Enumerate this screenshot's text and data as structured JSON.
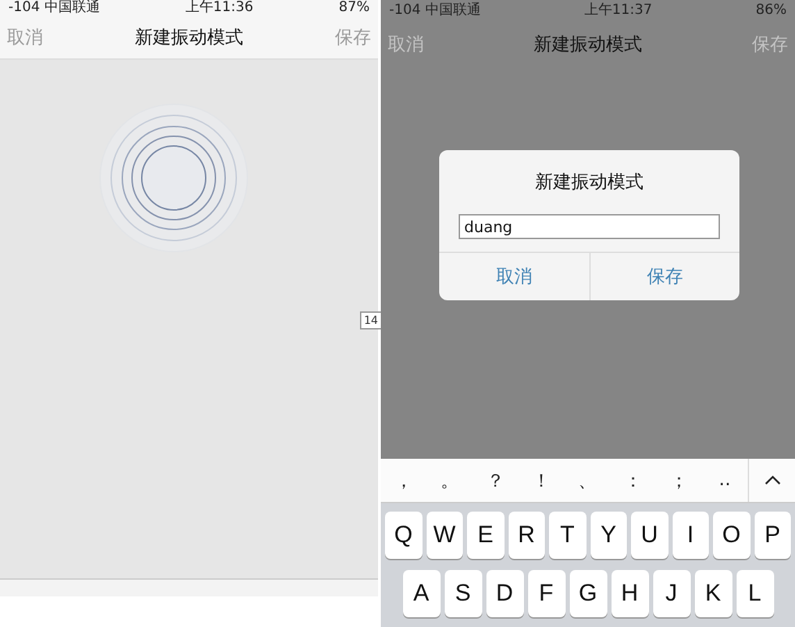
{
  "left_screen": {
    "status_bar": {
      "carrier": "-104 中国联通",
      "time": "上午11:36",
      "battery": "87%"
    },
    "nav": {
      "left": "取消",
      "title": "新建振动模式",
      "right": "保存"
    },
    "tag": "14"
  },
  "right_screen": {
    "status_bar": {
      "carrier": "-104 中国联通",
      "time": "上午11:37",
      "battery": "86%"
    },
    "nav": {
      "left": "取消",
      "title": "新建振动模式",
      "right": "保存"
    },
    "dialog": {
      "title": "新建振动模式",
      "input_value": "duang",
      "buttons": [
        "取消",
        "保存"
      ]
    },
    "keyboard": {
      "punctuation": [
        "，",
        "。",
        "？",
        "！",
        "、",
        "：",
        "；",
        "‥"
      ],
      "rows": [
        [
          "Q",
          "W",
          "E",
          "R",
          "T",
          "Y",
          "U",
          "I",
          "O",
          "P"
        ],
        [
          "A",
          "S",
          "D",
          "F",
          "G",
          "H",
          "J",
          "K",
          "L"
        ]
      ]
    }
  }
}
